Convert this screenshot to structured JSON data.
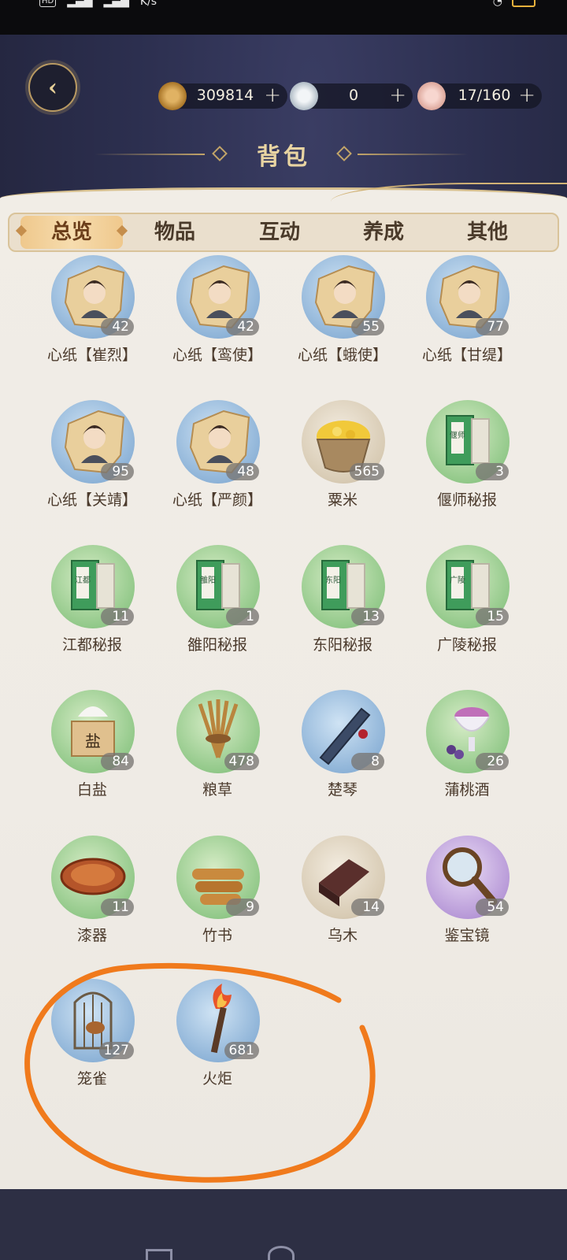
{
  "status_bar": {
    "hd_label": "HD",
    "speed": "K/s"
  },
  "header": {
    "title": "背包",
    "currencies": [
      {
        "name": "coin-icon",
        "value": "309814",
        "color": "#b7843b"
      },
      {
        "name": "silver-coin-icon",
        "value": "0",
        "color": "#c9d3da"
      },
      {
        "name": "food-bowl-icon",
        "value": "17/160",
        "color": "#e8b3a9"
      }
    ],
    "plus_label": "+"
  },
  "tabs": [
    {
      "label": "总览",
      "active": true
    },
    {
      "label": "物品",
      "active": false
    },
    {
      "label": "互动",
      "active": false
    },
    {
      "label": "养成",
      "active": false
    },
    {
      "label": "其他",
      "active": false
    }
  ],
  "items": [
    {
      "name": "心纸【崔烈】",
      "count": "42",
      "bg": "blue",
      "icon": "portrait-paper-icon"
    },
    {
      "name": "心纸【鸾使】",
      "count": "42",
      "bg": "blue",
      "icon": "portrait-paper-icon"
    },
    {
      "name": "心纸【蛾使】",
      "count": "55",
      "bg": "blue",
      "icon": "portrait-paper-icon"
    },
    {
      "name": "心纸【甘缇】",
      "count": "77",
      "bg": "blue",
      "icon": "portrait-paper-icon"
    },
    {
      "name": "心纸【关靖】",
      "count": "95",
      "bg": "blue",
      "icon": "portrait-paper-icon"
    },
    {
      "name": "心纸【严颜】",
      "count": "48",
      "bg": "blue",
      "icon": "portrait-paper-icon"
    },
    {
      "name": "粟米",
      "count": "565",
      "bg": "beige",
      "icon": "millet-basket-icon"
    },
    {
      "name": "偃师秘报",
      "count": "3",
      "bg": "green",
      "icon": "secret-report-book-icon",
      "book_label": "偃师"
    },
    {
      "name": "江都秘报",
      "count": "11",
      "bg": "green",
      "icon": "secret-report-book-icon",
      "book_label": "江都"
    },
    {
      "name": "雒阳秘报",
      "count": "1",
      "bg": "green",
      "icon": "secret-report-book-icon",
      "book_label": "雒阳"
    },
    {
      "name": "东阳秘报",
      "count": "13",
      "bg": "green",
      "icon": "secret-report-book-icon",
      "book_label": "东阳"
    },
    {
      "name": "广陵秘报",
      "count": "15",
      "bg": "green",
      "icon": "secret-report-book-icon",
      "book_label": "广陵"
    },
    {
      "name": "白盐",
      "count": "84",
      "bg": "green",
      "icon": "salt-box-icon",
      "box_label": "盐"
    },
    {
      "name": "粮草",
      "count": "478",
      "bg": "green",
      "icon": "grain-bundle-icon"
    },
    {
      "name": "楚琴",
      "count": "8",
      "bg": "blue",
      "icon": "zither-icon"
    },
    {
      "name": "蒲桃酒",
      "count": "26",
      "bg": "green",
      "icon": "wine-cup-icon"
    },
    {
      "name": "漆器",
      "count": "11",
      "bg": "green",
      "icon": "lacquer-bowl-icon"
    },
    {
      "name": "竹书",
      "count": "9",
      "bg": "green",
      "icon": "bamboo-scroll-icon"
    },
    {
      "name": "乌木",
      "count": "14",
      "bg": "beige",
      "icon": "ebony-wood-icon"
    },
    {
      "name": "鉴宝镜",
      "count": "54",
      "bg": "purple",
      "icon": "magnifier-icon"
    },
    {
      "name": "笼雀",
      "count": "127",
      "bg": "blue",
      "icon": "caged-bird-icon"
    },
    {
      "name": "火炬",
      "count": "681",
      "bg": "blue",
      "icon": "torch-icon"
    }
  ]
}
